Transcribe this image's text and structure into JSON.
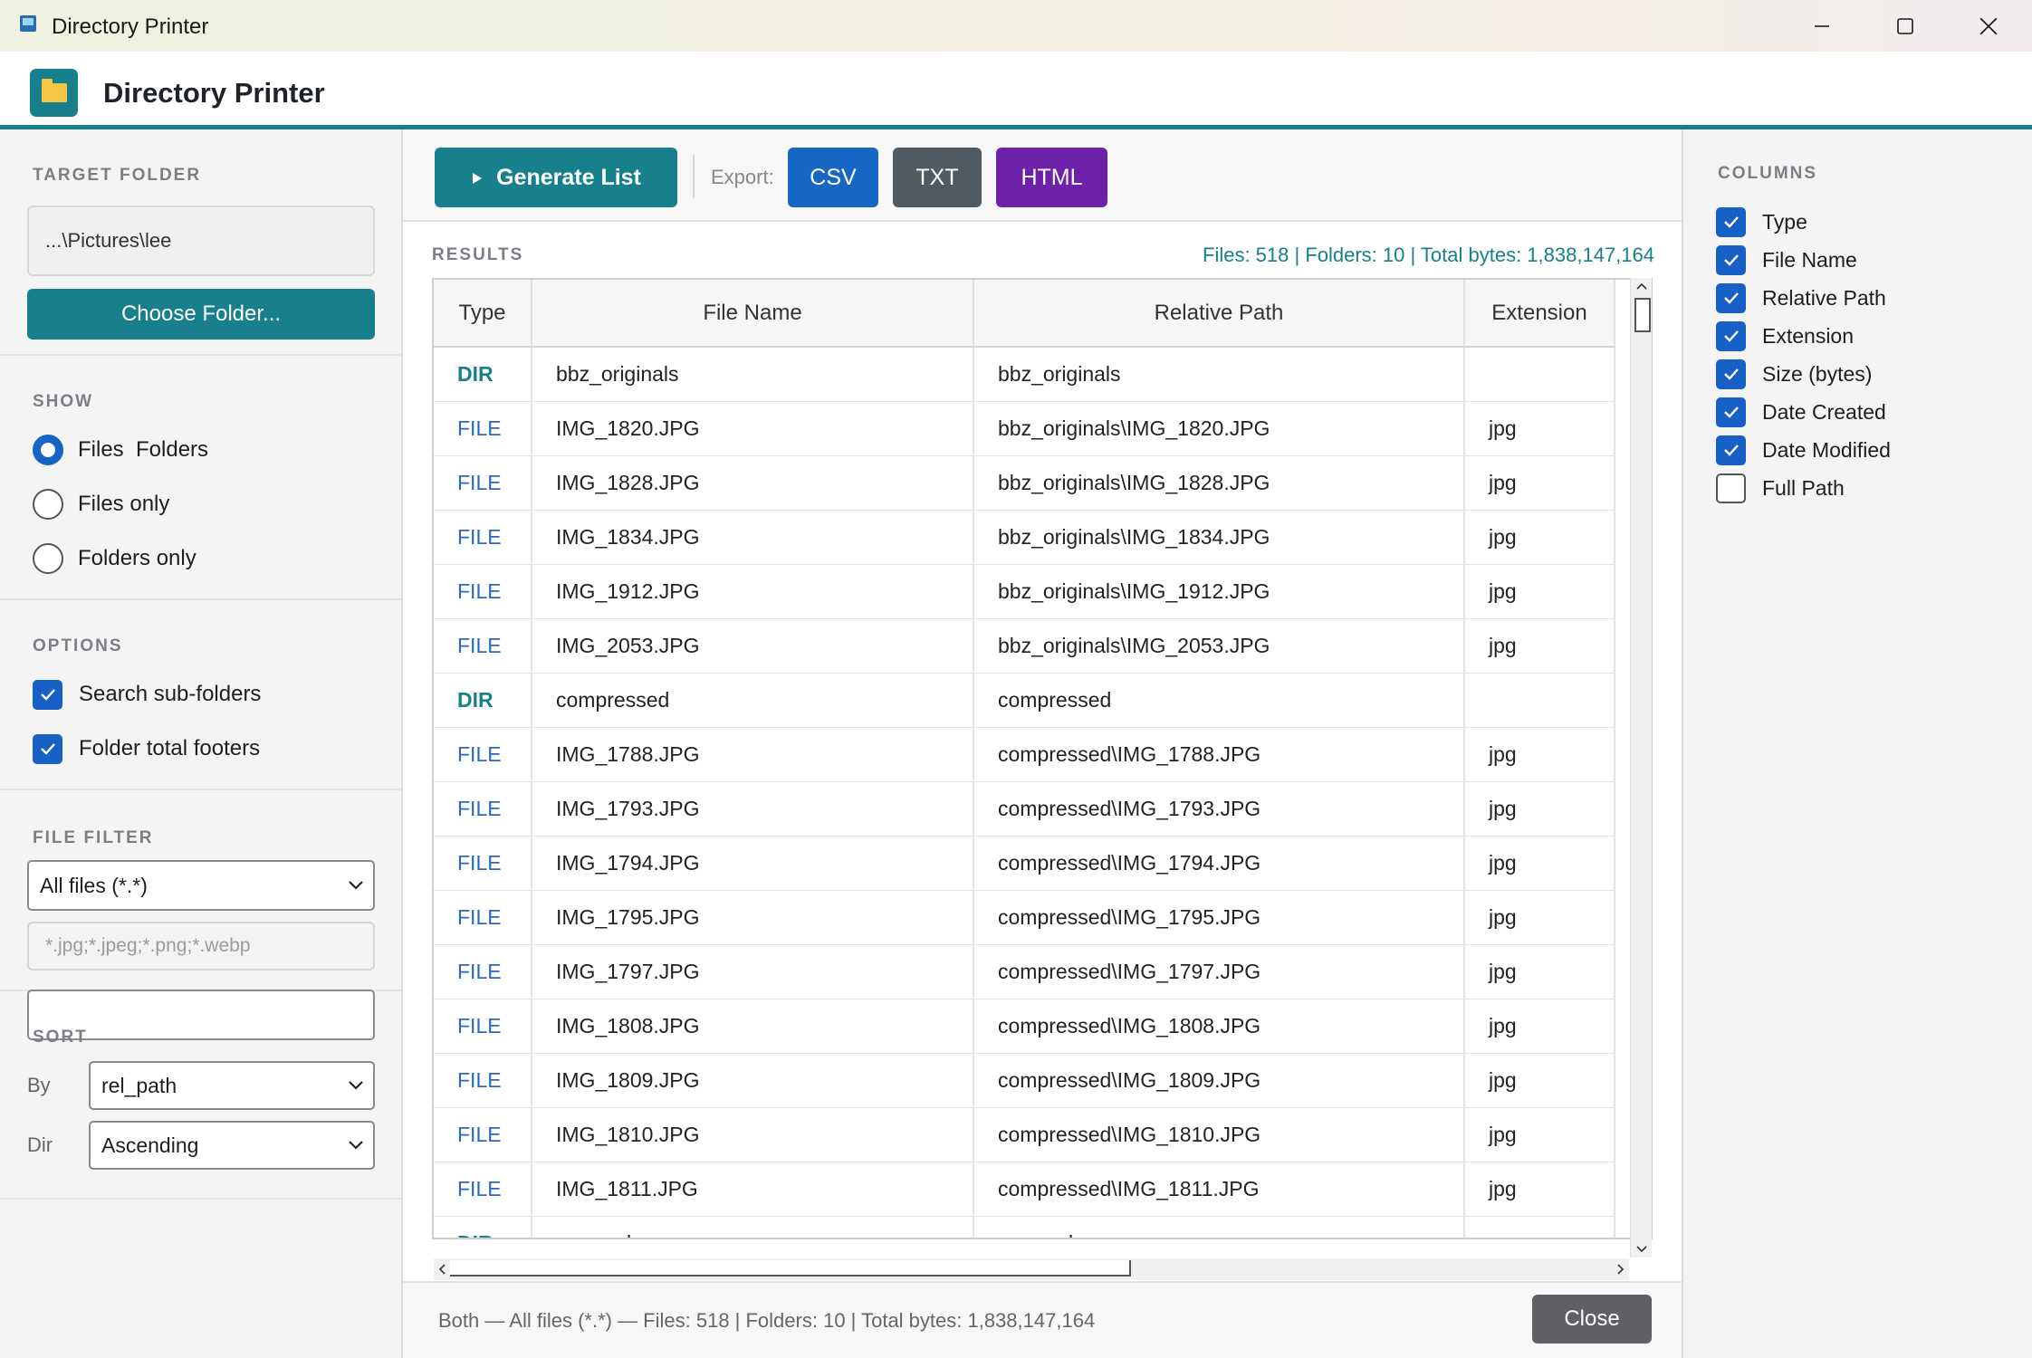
{
  "window": {
    "title": "Directory Printer",
    "controls": [
      "minimize",
      "maximize",
      "close"
    ]
  },
  "header": {
    "title": "Directory Printer",
    "logo_icon": "folder-icon"
  },
  "sidebar": {
    "target": {
      "label": "TARGET FOLDER",
      "path": "...\\Pictures\\lee",
      "choose_label": "Choose Folder..."
    },
    "show": {
      "label": "SHOW",
      "options": [
        {
          "label": "Files  Folders",
          "selected": true
        },
        {
          "label": "Files only",
          "selected": false
        },
        {
          "label": "Folders only",
          "selected": false
        }
      ]
    },
    "options": {
      "label": "OPTIONS",
      "items": [
        {
          "label": "Search sub-folders",
          "checked": true
        },
        {
          "label": "Folder total footers",
          "checked": true
        }
      ]
    },
    "filter": {
      "label": "FILE FILTER",
      "selected": "All files (*.*)",
      "placeholder": "*.jpg;*.jpeg;*.png;*.webp"
    },
    "sort": {
      "label": "SORT",
      "by_label": "By",
      "by_value": "rel_path",
      "dir_label": "Dir",
      "dir_value": "Ascending"
    }
  },
  "toolbar": {
    "generate_label": "Generate List",
    "export_label": "Export:",
    "csv_label": "CSV",
    "txt_label": "TXT",
    "html_label": "HTML",
    "colors": {
      "generate": "#17808c",
      "csv": "#1866c4",
      "txt": "#4f5a63",
      "html": "#6d21a8"
    }
  },
  "results": {
    "label": "RESULTS",
    "summary": "Files: 518 | Folders: 10 | Total bytes: 1,838,147,164",
    "columns": [
      "Type",
      "File Name",
      "Relative Path",
      "Extension"
    ],
    "rows": [
      {
        "type": "DIR",
        "name": "bbz_originals",
        "path": "bbz_originals",
        "ext": ""
      },
      {
        "type": "FILE",
        "name": "IMG_1820.JPG",
        "path": "bbz_originals\\IMG_1820.JPG",
        "ext": "jpg"
      },
      {
        "type": "FILE",
        "name": "IMG_1828.JPG",
        "path": "bbz_originals\\IMG_1828.JPG",
        "ext": "jpg"
      },
      {
        "type": "FILE",
        "name": "IMG_1834.JPG",
        "path": "bbz_originals\\IMG_1834.JPG",
        "ext": "jpg"
      },
      {
        "type": "FILE",
        "name": "IMG_1912.JPG",
        "path": "bbz_originals\\IMG_1912.JPG",
        "ext": "jpg"
      },
      {
        "type": "FILE",
        "name": "IMG_2053.JPG",
        "path": "bbz_originals\\IMG_2053.JPG",
        "ext": "jpg"
      },
      {
        "type": "DIR",
        "name": "compressed",
        "path": "compressed",
        "ext": ""
      },
      {
        "type": "FILE",
        "name": "IMG_1788.JPG",
        "path": "compressed\\IMG_1788.JPG",
        "ext": "jpg"
      },
      {
        "type": "FILE",
        "name": "IMG_1793.JPG",
        "path": "compressed\\IMG_1793.JPG",
        "ext": "jpg"
      },
      {
        "type": "FILE",
        "name": "IMG_1794.JPG",
        "path": "compressed\\IMG_1794.JPG",
        "ext": "jpg"
      },
      {
        "type": "FILE",
        "name": "IMG_1795.JPG",
        "path": "compressed\\IMG_1795.JPG",
        "ext": "jpg"
      },
      {
        "type": "FILE",
        "name": "IMG_1797.JPG",
        "path": "compressed\\IMG_1797.JPG",
        "ext": "jpg"
      },
      {
        "type": "FILE",
        "name": "IMG_1808.JPG",
        "path": "compressed\\IMG_1808.JPG",
        "ext": "jpg"
      },
      {
        "type": "FILE",
        "name": "IMG_1809.JPG",
        "path": "compressed\\IMG_1809.JPG",
        "ext": "jpg"
      },
      {
        "type": "FILE",
        "name": "IMG_1810.JPG",
        "path": "compressed\\IMG_1810.JPG",
        "ext": "jpg"
      },
      {
        "type": "FILE",
        "name": "IMG_1811.JPG",
        "path": "compressed\\IMG_1811.JPG",
        "ext": "jpg"
      },
      {
        "type": "DIR",
        "name": "cropped",
        "path": "cropped",
        "ext": ""
      }
    ]
  },
  "status": {
    "text": "Both — All files (*.*) — Files: 518 | Folders: 10 | Total bytes: 1,838,147,164",
    "close_label": "Close"
  },
  "columns_panel": {
    "label": "COLUMNS",
    "items": [
      {
        "label": "Type",
        "checked": true
      },
      {
        "label": "File Name",
        "checked": true
      },
      {
        "label": "Relative Path",
        "checked": true
      },
      {
        "label": "Extension",
        "checked": true
      },
      {
        "label": "Size (bytes)",
        "checked": true
      },
      {
        "label": "Date Created",
        "checked": true
      },
      {
        "label": "Date Modified",
        "checked": true
      },
      {
        "label": "Full Path",
        "checked": false
      }
    ]
  }
}
